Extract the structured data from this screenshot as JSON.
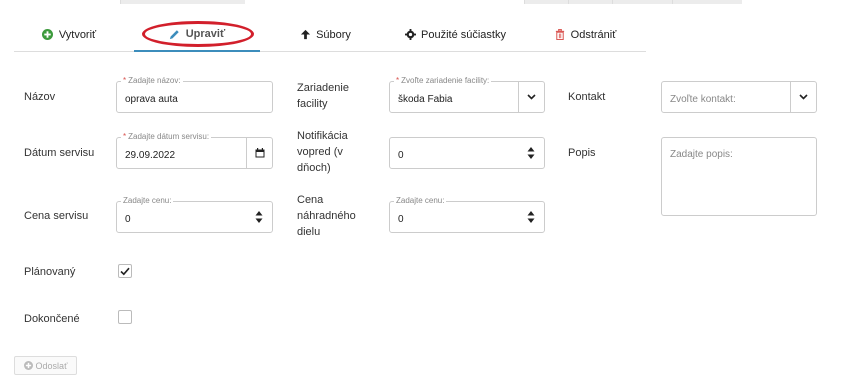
{
  "tabs": [
    {
      "label": "Vytvoriť",
      "icon": "plus-circle-icon"
    },
    {
      "label": "Upraviť",
      "icon": "pencil-icon"
    },
    {
      "label": "Súbory",
      "icon": "arrow-up-icon"
    },
    {
      "label": "Použité súčiastky",
      "icon": "gear-icon"
    },
    {
      "label": "Odstrániť",
      "icon": "trash-icon"
    }
  ],
  "form": {
    "name": {
      "label": "Názov",
      "float_label": "Zadajte názov:",
      "value": "oprava auta"
    },
    "facility": {
      "label": "Zariadenie facility",
      "float_label": "Zvoľte zariadenie facility:",
      "value": "škoda Fabia"
    },
    "contact": {
      "label": "Kontakt",
      "placeholder": "Zvoľte kontakt:"
    },
    "service_date": {
      "label": "Dátum servisu",
      "float_label": "Zadajte dátum servisu:",
      "value": "29.09.2022"
    },
    "notify_days": {
      "label": "Notifikácia vopred (v dňoch)",
      "value": "0"
    },
    "description": {
      "label": "Popis",
      "placeholder": "Zadajte popis:"
    },
    "service_price": {
      "label": "Cena servisu",
      "float_label": "Zadajte cenu:",
      "value": "0"
    },
    "part_price": {
      "label": "Cena náhradného dielu",
      "float_label": "Zadajte cenu:",
      "value": "0"
    },
    "planned": {
      "label": "Plánovaný",
      "checked": true
    },
    "completed": {
      "label": "Dokončené",
      "checked": false
    }
  },
  "send_label": "Odoslať",
  "colors": {
    "accent": "#3c8dbc",
    "add_icon": "#3c9a3c",
    "edit_icon": "#3c8dbc",
    "delete_icon": "#d9534f",
    "annotation": "#d21f2b"
  }
}
